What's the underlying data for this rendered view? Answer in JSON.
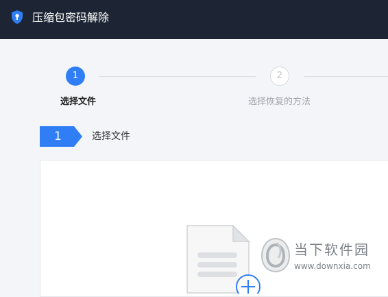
{
  "window": {
    "title": "压缩包密码解除",
    "icon": "shield-keyhole-icon",
    "titlebar_color": "#1d2433"
  },
  "steps": [
    {
      "number": "1",
      "label": "选择文件",
      "state": "active"
    },
    {
      "number": "2",
      "label": "选择恢复的方法",
      "state": "inactive"
    }
  ],
  "section": {
    "number": "1",
    "title": "选择文件"
  },
  "dropzone": {
    "icon": "document-add-icon"
  },
  "watermark": {
    "name": "当下软件园",
    "url": "www.downxia.com"
  },
  "colors": {
    "accent": "#2f7ef5",
    "inactive": "#c4c8ce",
    "background": "#f3f5f8"
  }
}
